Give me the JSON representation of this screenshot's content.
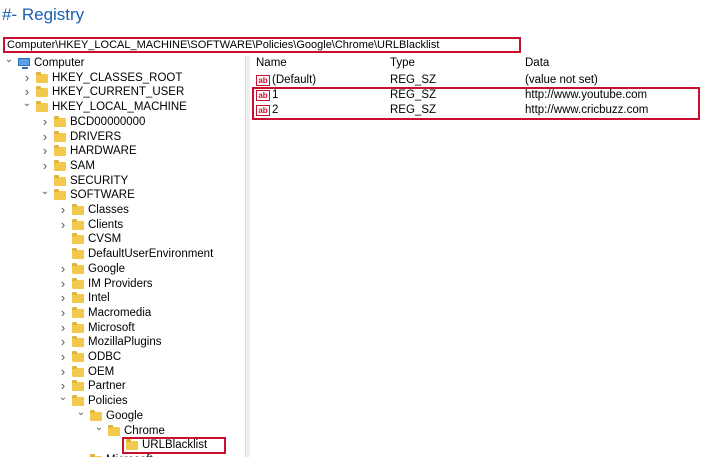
{
  "heading": "#- Registry",
  "address_path": "Computer\\HKEY_LOCAL_MACHINE\\SOFTWARE\\Policies\\Google\\Chrome\\URLBlacklist",
  "tree": [
    {
      "label": "Computer",
      "level": 0,
      "state": "expanded",
      "icon": "computer-icon"
    },
    {
      "label": "HKEY_CLASSES_ROOT",
      "level": 1,
      "state": "collapsed",
      "icon": "folder-icon"
    },
    {
      "label": "HKEY_CURRENT_USER",
      "level": 1,
      "state": "collapsed",
      "icon": "folder-icon"
    },
    {
      "label": "HKEY_LOCAL_MACHINE",
      "level": 1,
      "state": "expanded",
      "icon": "folder-icon"
    },
    {
      "label": "BCD00000000",
      "level": 2,
      "state": "collapsed",
      "icon": "folder-icon"
    },
    {
      "label": "DRIVERS",
      "level": 2,
      "state": "collapsed",
      "icon": "folder-icon"
    },
    {
      "label": "HARDWARE",
      "level": 2,
      "state": "collapsed",
      "icon": "folder-icon"
    },
    {
      "label": "SAM",
      "level": 2,
      "state": "collapsed",
      "icon": "folder-icon"
    },
    {
      "label": "SECURITY",
      "level": 2,
      "state": "leaf",
      "icon": "folder-icon"
    },
    {
      "label": "SOFTWARE",
      "level": 2,
      "state": "expanded",
      "icon": "folder-icon"
    },
    {
      "label": "Classes",
      "level": 3,
      "state": "collapsed",
      "icon": "folder-icon"
    },
    {
      "label": "Clients",
      "level": 3,
      "state": "collapsed",
      "icon": "folder-icon"
    },
    {
      "label": "CVSM",
      "level": 3,
      "state": "leaf",
      "icon": "folder-icon"
    },
    {
      "label": "DefaultUserEnvironment",
      "level": 3,
      "state": "leaf",
      "icon": "folder-icon"
    },
    {
      "label": "Google",
      "level": 3,
      "state": "collapsed",
      "icon": "folder-icon"
    },
    {
      "label": "IM Providers",
      "level": 3,
      "state": "collapsed",
      "icon": "folder-icon"
    },
    {
      "label": "Intel",
      "level": 3,
      "state": "collapsed",
      "icon": "folder-icon"
    },
    {
      "label": "Macromedia",
      "level": 3,
      "state": "collapsed",
      "icon": "folder-icon"
    },
    {
      "label": "Microsoft",
      "level": 3,
      "state": "collapsed",
      "icon": "folder-icon"
    },
    {
      "label": "MozillaPlugins",
      "level": 3,
      "state": "collapsed",
      "icon": "folder-icon"
    },
    {
      "label": "ODBC",
      "level": 3,
      "state": "collapsed",
      "icon": "folder-icon"
    },
    {
      "label": "OEM",
      "level": 3,
      "state": "collapsed",
      "icon": "folder-icon"
    },
    {
      "label": "Partner",
      "level": 3,
      "state": "collapsed",
      "icon": "folder-icon"
    },
    {
      "label": "Policies",
      "level": 3,
      "state": "expanded",
      "icon": "folder-icon"
    },
    {
      "label": "Google",
      "level": 4,
      "state": "expanded",
      "icon": "folder-icon"
    },
    {
      "label": "Chrome",
      "level": 5,
      "state": "expanded",
      "icon": "folder-icon"
    },
    {
      "label": "URLBlacklist",
      "level": 6,
      "state": "selected",
      "icon": "folder-icon"
    },
    {
      "label": "Microsoft",
      "level": 4,
      "state": "collapsed",
      "icon": "folder-icon"
    }
  ],
  "columns": {
    "name": "Name",
    "type": "Type",
    "data": "Data"
  },
  "values": [
    {
      "name": "(Default)",
      "type": "REG_SZ",
      "data": "(value not set)",
      "icon_text": "ab"
    },
    {
      "name": "1",
      "type": "REG_SZ",
      "data": "http://www.youtube.com",
      "icon_text": "ab"
    },
    {
      "name": "2",
      "type": "REG_SZ",
      "data": "http://www.cricbuzz.com",
      "icon_text": "ab"
    }
  ],
  "colors": {
    "highlight": "#c8102e",
    "heading": "#1a5fb4",
    "folder": "#f2c94c"
  }
}
